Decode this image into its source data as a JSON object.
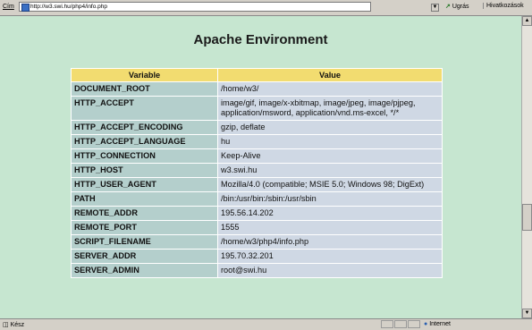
{
  "addressbar": {
    "label": "Cím",
    "url": "http://w3.swi.hu/php4/info.php",
    "go_label": "Ugrás",
    "links_label": "Hivatkozások"
  },
  "page": {
    "title": "Apache Environment",
    "table": {
      "headers": [
        "Variable",
        "Value"
      ],
      "rows": [
        {
          "variable": "DOCUMENT_ROOT",
          "value": "/home/w3/"
        },
        {
          "variable": "HTTP_ACCEPT",
          "value": "image/gif, image/x-xbitmap, image/jpeg, image/pjpeg, application/msword, application/vnd.ms-excel, */*"
        },
        {
          "variable": "HTTP_ACCEPT_ENCODING",
          "value": "gzip, deflate"
        },
        {
          "variable": "HTTP_ACCEPT_LANGUAGE",
          "value": "hu"
        },
        {
          "variable": "HTTP_CONNECTION",
          "value": "Keep-Alive"
        },
        {
          "variable": "HTTP_HOST",
          "value": "w3.swi.hu"
        },
        {
          "variable": "HTTP_USER_AGENT",
          "value": "Mozilla/4.0 (compatible; MSIE 5.0; Windows 98; DigExt)"
        },
        {
          "variable": "PATH",
          "value": "/bin:/usr/bin:/sbin:/usr/sbin"
        },
        {
          "variable": "REMOTE_ADDR",
          "value": "195.56.14.202"
        },
        {
          "variable": "REMOTE_PORT",
          "value": "1555"
        },
        {
          "variable": "SCRIPT_FILENAME",
          "value": "/home/w3/php4/info.php"
        },
        {
          "variable": "SERVER_ADDR",
          "value": "195.70.32.201"
        },
        {
          "variable": "SERVER_ADMIN",
          "value": "root@swi.hu"
        }
      ]
    }
  },
  "statusbar": {
    "status": "Kész",
    "zone": "Internet"
  }
}
